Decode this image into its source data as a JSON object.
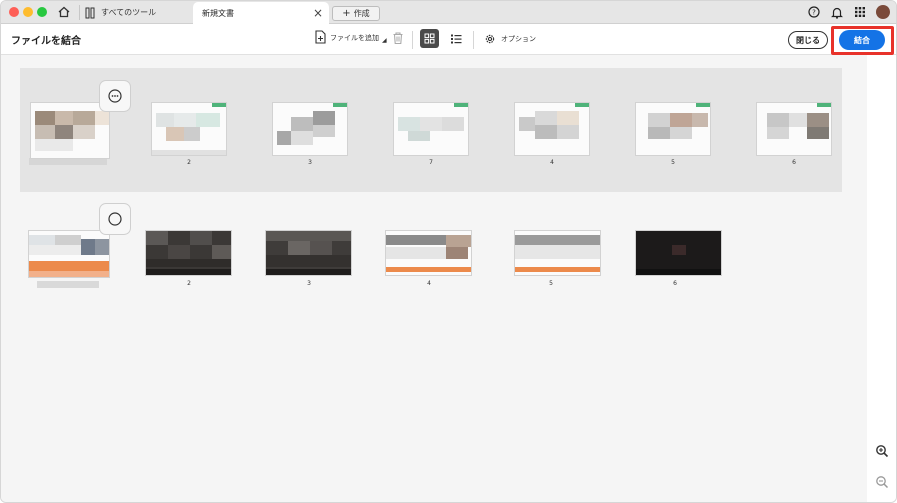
{
  "titlebar": {
    "tools_tab_label": "すべてのツール",
    "document_tab_label": "新規文書",
    "new_tab_label": "作成"
  },
  "toolbar": {
    "page_title": "ファイルを結合",
    "add_files_label": "ファイルを追加",
    "options_label": "オプション",
    "close_label": "閉じる",
    "combine_label": "結合"
  },
  "groups": [
    {
      "page_numbers": [
        "2",
        "3",
        "7",
        "4",
        "5",
        "6"
      ]
    },
    {
      "page_numbers": [
        "2",
        "3",
        "4",
        "5",
        "6"
      ]
    }
  ],
  "colors": {
    "accent": "#1473e6",
    "highlight": "#e8322a",
    "selection": "#e4e4e4"
  }
}
